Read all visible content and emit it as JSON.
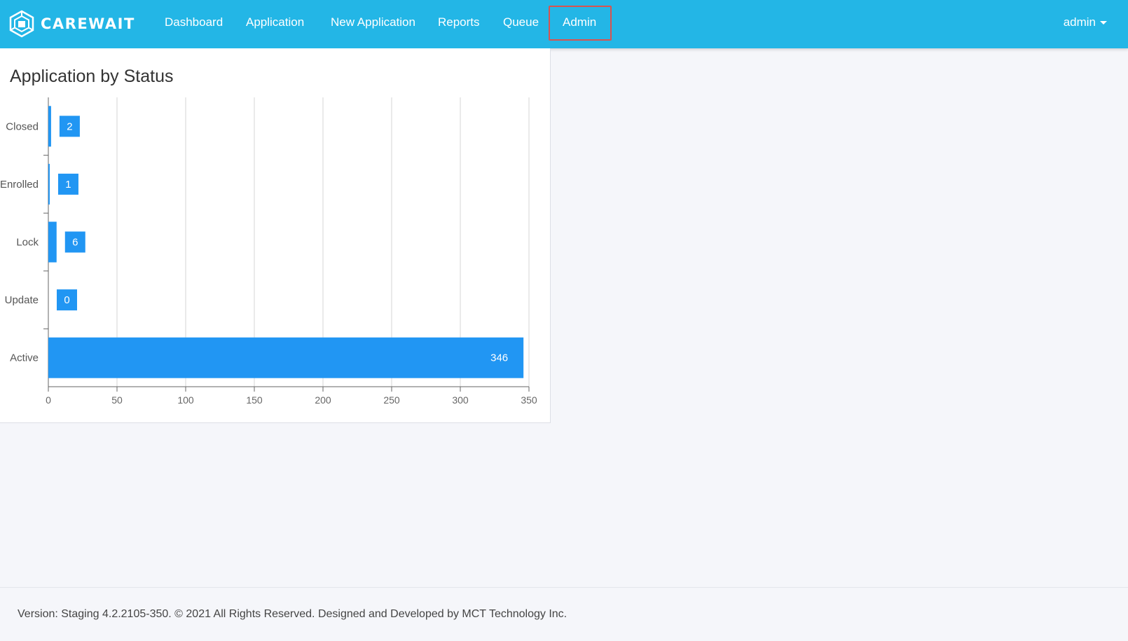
{
  "header": {
    "brand": "CAREWAIT",
    "nav": [
      {
        "label": "Dashboard"
      },
      {
        "label": "Application"
      },
      {
        "label": "New Application"
      },
      {
        "label": "Reports"
      },
      {
        "label": "Queue"
      },
      {
        "label": "Admin"
      }
    ],
    "user": "admin"
  },
  "card": {
    "title": "Application by Status"
  },
  "chart_data": {
    "type": "bar",
    "orientation": "horizontal",
    "categories": [
      "Closed",
      "Enrolled",
      "Lock",
      "Update",
      "Active"
    ],
    "values": [
      2,
      1,
      6,
      0,
      346
    ],
    "xlim": [
      0,
      350
    ],
    "xticks": [
      0,
      50,
      100,
      150,
      200,
      250,
      300,
      350
    ],
    "grid": "vertical",
    "bar_color": "#2196f3"
  },
  "footer": {
    "text": "Version: Staging 4.2.2105-350. © 2021 All Rights Reserved. Designed and Developed by MCT Technology Inc."
  }
}
